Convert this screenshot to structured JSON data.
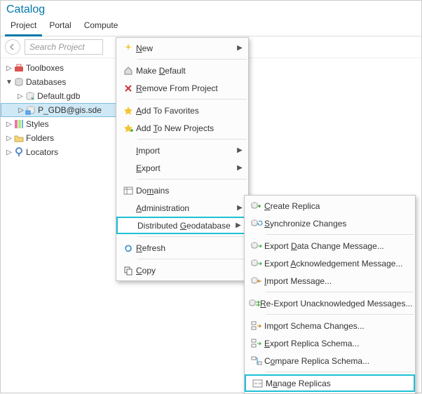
{
  "title": "Catalog",
  "tabs": {
    "project": "Project",
    "portal": "Portal",
    "compute": "Compute"
  },
  "search": {
    "placeholder": "Search Project"
  },
  "tree": {
    "toolboxes": "Toolboxes",
    "databases": "Databases",
    "default_gdb": "Default.gdb",
    "sde": "P_GDB@gis.sde",
    "styles": "Styles",
    "folders": "Folders",
    "locators": "Locators"
  },
  "menu1": {
    "new": "New",
    "make_default": "Make Default",
    "remove": "Remove From Project",
    "add_fav": "Add To Favorites",
    "add_new_proj": "Add To New Projects",
    "import": "Import",
    "export": "Export",
    "domains": "Domains",
    "admin": "Administration",
    "dist_geo": "Distributed Geodatabase",
    "refresh": "Refresh",
    "copy": "Copy"
  },
  "menu2": {
    "create": "Create Replica",
    "sync": "Synchronize Changes",
    "export_data": "Export Data Change Message...",
    "export_ack": "Export Acknowledgement Message...",
    "import_msg": "Import Message...",
    "reexport": "Re-Export Unacknowledged Messages...",
    "import_schema": "Import Schema Changes...",
    "export_schema": "Export Replica Schema...",
    "compare_schema": "Compare Replica Schema...",
    "manage": "Manage Replicas"
  },
  "icons": {
    "back": "back-arrow-icon",
    "toolbox": "toolbox-icon",
    "databases": "databases-icon",
    "gdb": "gdb-icon",
    "sde": "sde-icon",
    "styles": "styles-icon",
    "folder": "folder-icon",
    "locators": "locators-icon",
    "new": "sparkle-icon",
    "home": "home-icon",
    "remove": "remove-x-icon",
    "star": "star-icon",
    "star_add": "star-add-icon",
    "domains": "domains-icon",
    "refresh": "refresh-icon",
    "copy": "copy-icon",
    "replica": "replica-icon",
    "sync": "sync-icon",
    "export_msg": "export-msg-icon",
    "import_msg": "import-msg-icon",
    "schema": "schema-icon",
    "manage": "manage-icon"
  }
}
